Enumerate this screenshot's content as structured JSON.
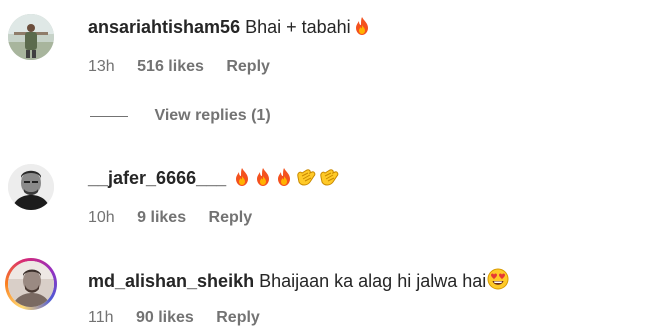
{
  "comments": [
    {
      "username": "ansariahtisham56",
      "text": "Bhai + tabahi",
      "emojis": [
        "fire-emoji"
      ],
      "time": "13h",
      "likes": "516 likes",
      "reply": "Reply"
    },
    {
      "username": "__jafer_6666___",
      "text": "",
      "emojis": [
        "fire-emoji",
        "fire-emoji",
        "fire-emoji",
        "clapping-hands-emoji",
        "clapping-hands-emoji"
      ],
      "time": "10h",
      "likes": "9 likes",
      "reply": "Reply"
    },
    {
      "username": "md_alishan_sheikh",
      "text": "Bhaijaan ka alag hi jalwa hai",
      "emojis": [
        "heart-eyes-emoji"
      ],
      "time": "11h",
      "likes": "90 likes",
      "reply": "Reply"
    }
  ],
  "view_replies": "View replies (1)",
  "colors": {
    "text_primary": "#262626",
    "text_secondary": "#737373",
    "story_ring": [
      "#feda75",
      "#fa7e1e",
      "#d62976",
      "#962fbf",
      "#4f5bd5"
    ]
  }
}
